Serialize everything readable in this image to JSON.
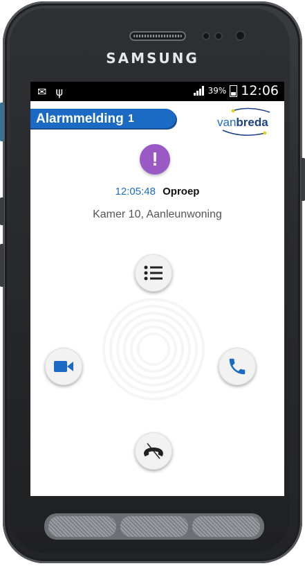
{
  "device": {
    "brand": "SAMSUNG"
  },
  "status_bar": {
    "battery": "39%",
    "time": "12:06"
  },
  "alarm": {
    "title": "Alarmmelding",
    "count": "1",
    "logo": {
      "part1": "van",
      "part2": "breda"
    },
    "time": "12:05:48",
    "type": "Oproep",
    "location": "Kamer 10, Aanleunwoning"
  },
  "colors": {
    "accent_blue": "#1b6bc5",
    "alert_purple": "#9b59c6"
  },
  "icons": [
    "mail-icon",
    "usb-icon",
    "signal-icon",
    "battery-icon",
    "alert-icon",
    "list-icon",
    "video-camera-icon",
    "phone-icon",
    "hang-up-icon"
  ]
}
